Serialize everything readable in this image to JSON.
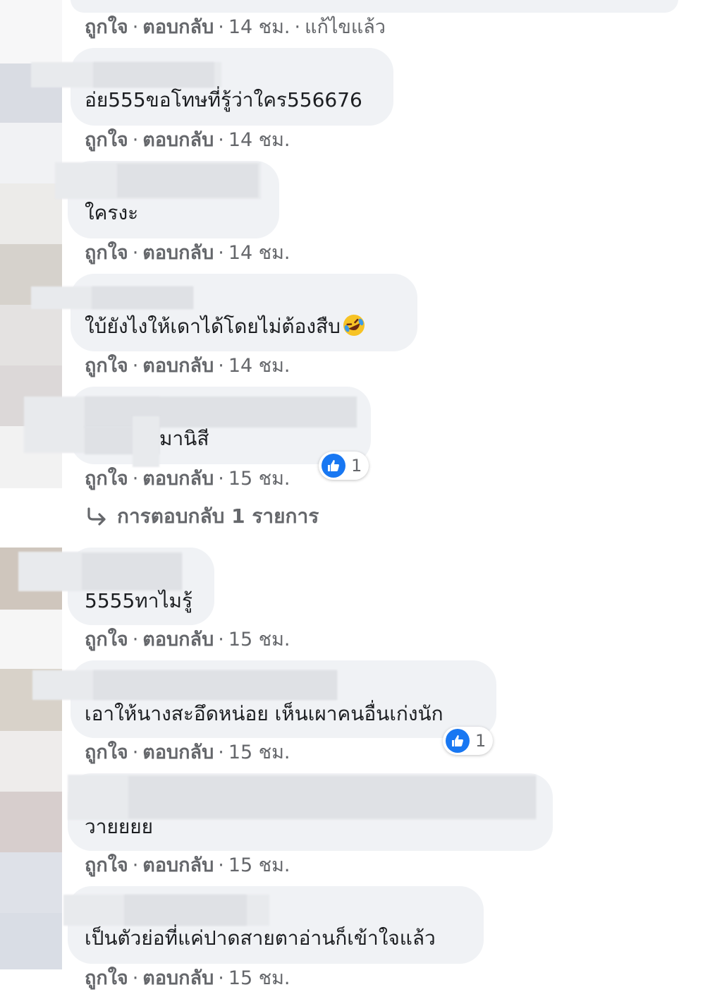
{
  "actions": {
    "like": "ถูกใจ",
    "reply": "ตอบกลับ",
    "separator": "·",
    "edited": "แก้ไขแล้ว"
  },
  "comments": [
    {
      "text": "",
      "time": "14 ชม."
    },
    {
      "text": "อ่ย555ขอโทษที่รู้ว่าใคร556676",
      "time": "14 ชม."
    },
    {
      "text": "ใครงะ",
      "time": "14 ชม."
    },
    {
      "text": "ใบ้ยังไงให้เดาได้โดยไม่ต้องสืบ",
      "time": "14 ชม.",
      "emoji": "rolling-laughing-emoji"
    },
    {
      "text": "มานิสี",
      "time": "15 ชม.",
      "reaction_count": "1"
    },
    {
      "text": "5555ทาไมรู้",
      "time": "15 ชม."
    },
    {
      "text": "เอาให้นางสะอึดหน่อย เห็นเผาคนอื่นเก่งนัก",
      "time": "15 ชม.",
      "reaction_count": "1"
    },
    {
      "text": "วายยยย",
      "time": "15 ชม."
    },
    {
      "text": "เป็นตัวย่อที่แค่ปาดสายตาอ่านก็เข้าใจแล้ว",
      "time": "15 ชม."
    }
  ],
  "replies_link": "การตอบกลับ 1 รายการ",
  "icons": {
    "like": "like-thumb-icon",
    "reply_arrow": "reply-arrow-icon"
  },
  "colors": {
    "bubble": "#f0f2f5",
    "muted_text": "#65676b",
    "like_blue": "#1877f2"
  }
}
